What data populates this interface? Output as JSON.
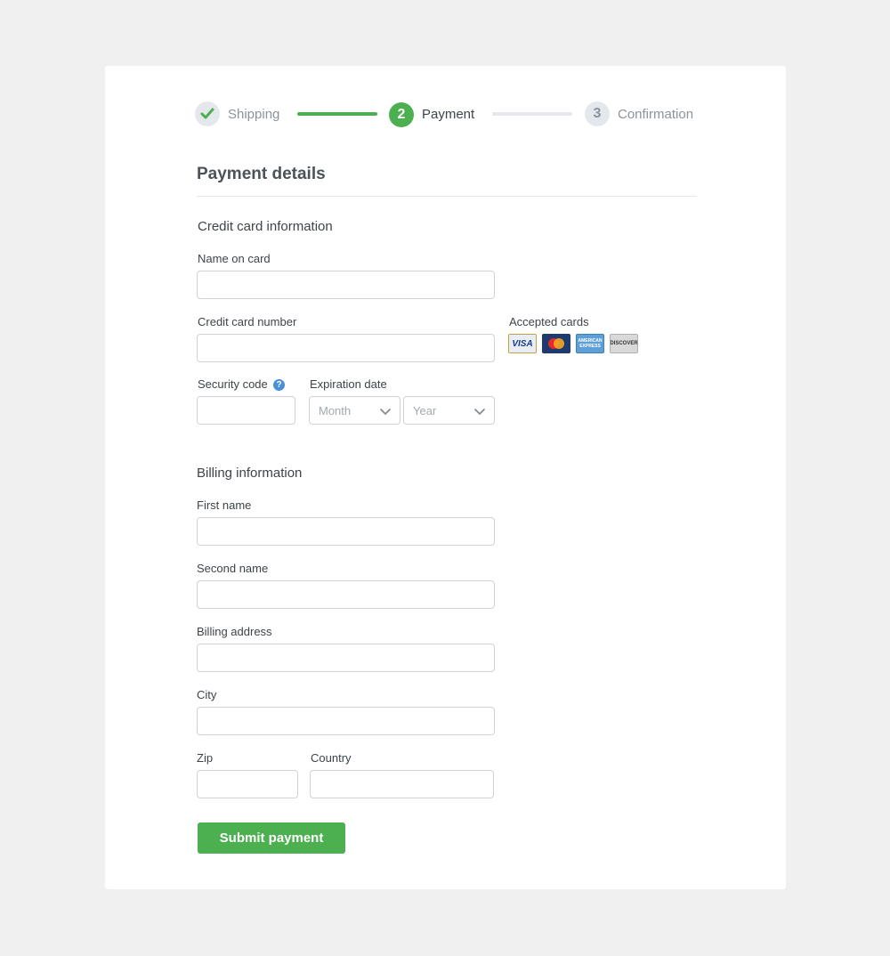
{
  "stepper": {
    "steps": [
      {
        "label": "Shipping",
        "status": "done"
      },
      {
        "label": "Payment",
        "number": "2",
        "status": "active"
      },
      {
        "label": "Confirmation",
        "number": "3",
        "status": "todo"
      }
    ]
  },
  "page_title": "Payment details",
  "credit_card": {
    "section_title": "Credit card information",
    "name_label": "Name on card",
    "number_label": "Credit card number",
    "accepted_label": "Accepted cards",
    "cards": [
      {
        "name": "visa-card-icon",
        "text": "VISA"
      },
      {
        "name": "mastercard-icon",
        "text": ""
      },
      {
        "name": "amex-card-icon",
        "text": "AMERICAN EXPRESS"
      },
      {
        "name": "discover-card-icon",
        "text": "DISCOVER"
      }
    ],
    "security_label": "Security code",
    "expiration_label": "Expiration date",
    "month_placeholder": "Month",
    "year_placeholder": "Year"
  },
  "billing": {
    "section_title": "Billing information",
    "first_name_label": "First name",
    "second_name_label": "Second name",
    "address_label": "Billing address",
    "city_label": "City",
    "zip_label": "Zip",
    "country_label": "Country"
  },
  "submit_label": "Submit payment",
  "colors": {
    "accent": "#4caf50",
    "help": "#4a90d9",
    "background": "#f0f0f0"
  }
}
